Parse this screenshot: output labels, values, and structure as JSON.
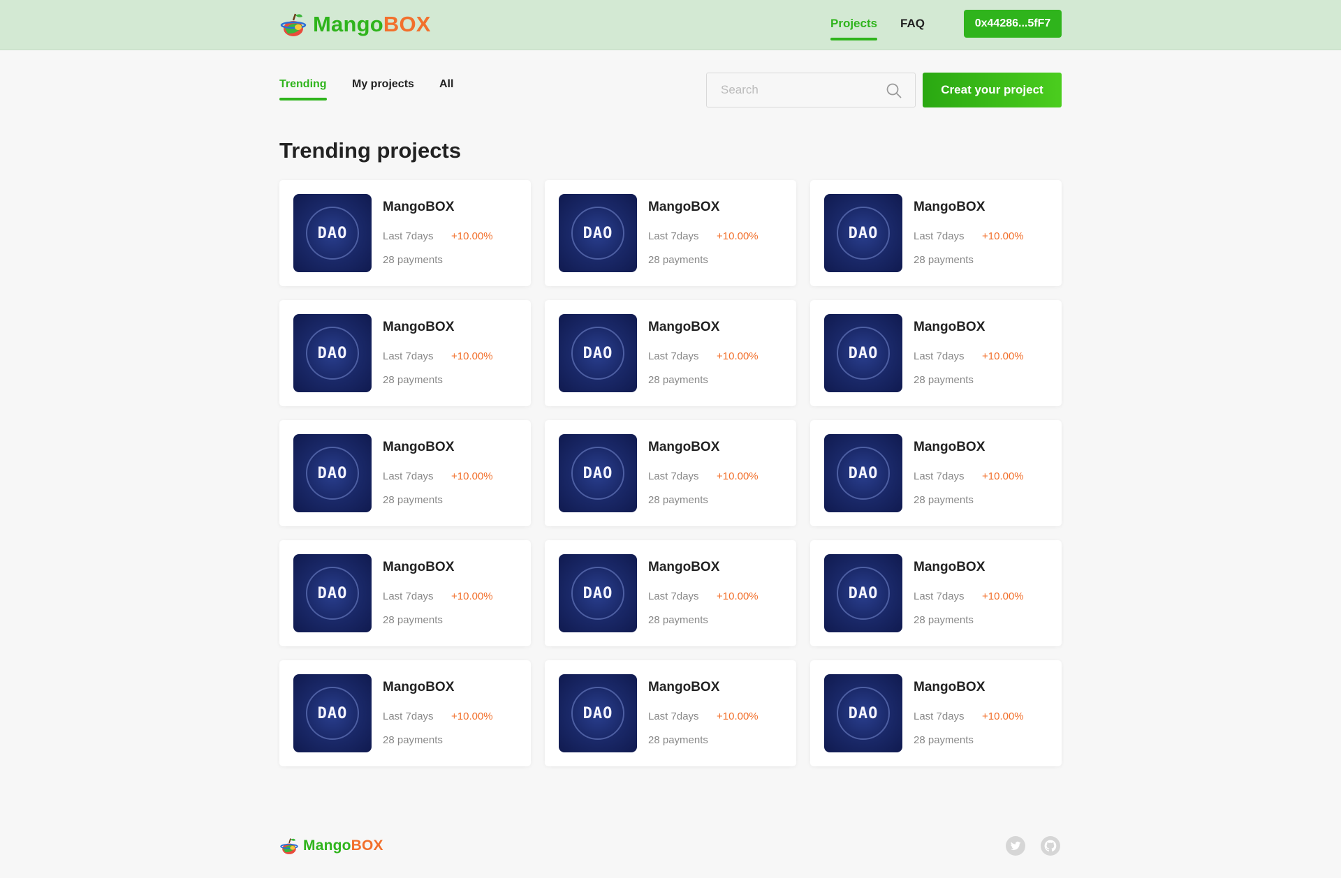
{
  "header": {
    "logo": {
      "part1": "Mango",
      "part2": "BOX"
    },
    "nav": [
      {
        "label": "Projects",
        "active": true
      },
      {
        "label": "FAQ",
        "active": false
      }
    ],
    "wallet_label": "0x44286...5fF7"
  },
  "tabs": [
    {
      "label": "Trending",
      "active": true
    },
    {
      "label": "My projects",
      "active": false
    },
    {
      "label": "All",
      "active": false
    }
  ],
  "search": {
    "placeholder": "Search",
    "value": ""
  },
  "create_button": "Creat your project",
  "section_title": "Trending projects",
  "projects": [
    {
      "name": "MangoBOX",
      "period": "Last 7days",
      "change": "+10.00%",
      "payments": "28 payments"
    },
    {
      "name": "MangoBOX",
      "period": "Last 7days",
      "change": "+10.00%",
      "payments": "28 payments"
    },
    {
      "name": "MangoBOX",
      "period": "Last 7days",
      "change": "+10.00%",
      "payments": "28 payments"
    },
    {
      "name": "MangoBOX",
      "period": "Last 7days",
      "change": "+10.00%",
      "payments": "28 payments"
    },
    {
      "name": "MangoBOX",
      "period": "Last 7days",
      "change": "+10.00%",
      "payments": "28 payments"
    },
    {
      "name": "MangoBOX",
      "period": "Last 7days",
      "change": "+10.00%",
      "payments": "28 payments"
    },
    {
      "name": "MangoBOX",
      "period": "Last 7days",
      "change": "+10.00%",
      "payments": "28 payments"
    },
    {
      "name": "MangoBOX",
      "period": "Last 7days",
      "change": "+10.00%",
      "payments": "28 payments"
    },
    {
      "name": "MangoBOX",
      "period": "Last 7days",
      "change": "+10.00%",
      "payments": "28 payments"
    },
    {
      "name": "MangoBOX",
      "period": "Last 7days",
      "change": "+10.00%",
      "payments": "28 payments"
    },
    {
      "name": "MangoBOX",
      "period": "Last 7days",
      "change": "+10.00%",
      "payments": "28 payments"
    },
    {
      "name": "MangoBOX",
      "period": "Last 7days",
      "change": "+10.00%",
      "payments": "28 payments"
    },
    {
      "name": "MangoBOX",
      "period": "Last 7days",
      "change": "+10.00%",
      "payments": "28 payments"
    },
    {
      "name": "MangoBOX",
      "period": "Last 7days",
      "change": "+10.00%",
      "payments": "28 payments"
    },
    {
      "name": "MangoBOX",
      "period": "Last 7days",
      "change": "+10.00%",
      "payments": "28 payments"
    }
  ],
  "project_thumb_text": "DAO",
  "footer": {
    "logo": {
      "part1": "Mango",
      "part2": "BOX"
    },
    "social_icons": [
      "twitter-icon",
      "github-icon"
    ]
  },
  "colors": {
    "brand_green": "#2fb41c",
    "brand_orange": "#f2702c",
    "header_bg": "#d3e9d3",
    "page_bg": "#f7f7f7"
  }
}
